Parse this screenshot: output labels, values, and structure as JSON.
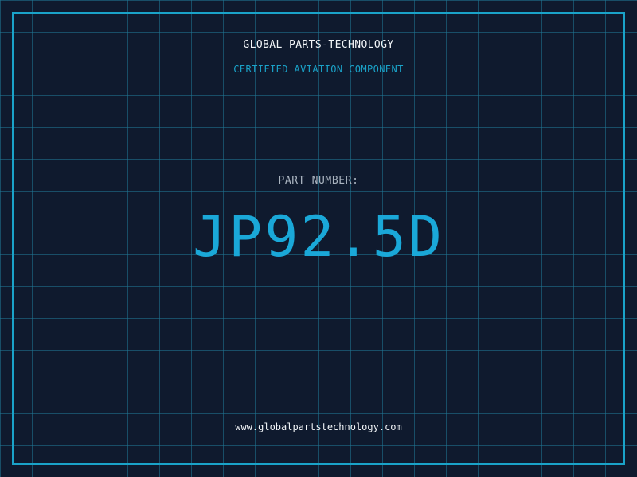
{
  "header": {
    "company_name": "GLOBAL PARTS-TECHNOLOGY",
    "tagline": "CERTIFIED AVIATION COMPONENT"
  },
  "part": {
    "label": "PART NUMBER:",
    "number": "JP92.5D"
  },
  "footer": {
    "website": "www.globalpartstechnology.com"
  },
  "colors": {
    "background": "#0f1a2e",
    "accent": "#1aa3c9",
    "grid": "#207896",
    "text_light": "#f2f5f8",
    "text_muted": "#aab4c0"
  }
}
